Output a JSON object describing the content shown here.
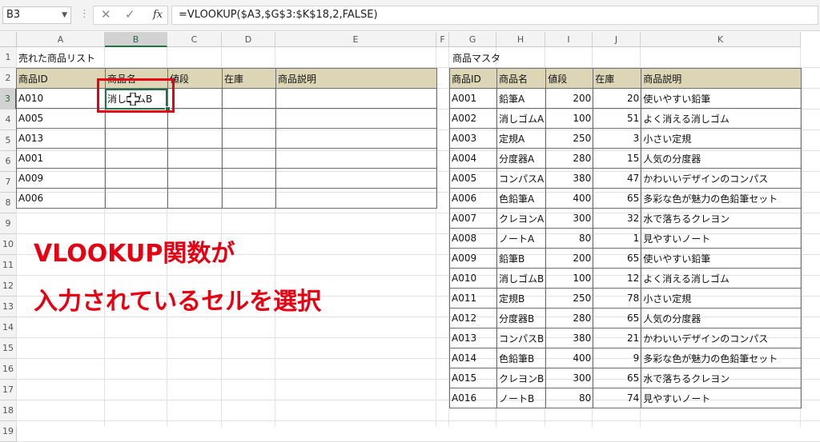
{
  "formula_bar": {
    "name_box": "B3",
    "more_icon": "more-vertical-icon",
    "cancel_icon": "cancel-icon",
    "enter_icon": "check-icon",
    "fx_label": "fx",
    "formula": "=VLOOKUP($A3,$G$3:$K$18,2,FALSE)"
  },
  "columns": [
    "A",
    "B",
    "C",
    "D",
    "E",
    "F",
    "G",
    "H",
    "I",
    "J",
    "K"
  ],
  "selected_column": "B",
  "rows": [
    "1",
    "2",
    "3",
    "4",
    "5",
    "6",
    "7",
    "8",
    "9",
    "10",
    "11",
    "12",
    "13",
    "14",
    "15",
    "16",
    "17",
    "18",
    "19"
  ],
  "selected_row": "3",
  "sold_list": {
    "title": "売れた商品リスト",
    "headers": [
      "商品ID",
      "商品名",
      "値段",
      "在庫",
      "商品説明"
    ],
    "rows": [
      [
        "A010",
        "消しゴムB",
        "",
        "",
        ""
      ],
      [
        "A005",
        "",
        "",
        "",
        ""
      ],
      [
        "A013",
        "",
        "",
        "",
        ""
      ],
      [
        "A001",
        "",
        "",
        "",
        ""
      ],
      [
        "A009",
        "",
        "",
        "",
        ""
      ],
      [
        "A006",
        "",
        "",
        "",
        ""
      ]
    ]
  },
  "master": {
    "title": "商品マスタ",
    "headers": [
      "商品ID",
      "商品名",
      "値段",
      "在庫",
      "商品説明"
    ],
    "rows": [
      [
        "A001",
        "鉛筆A",
        "200",
        "20",
        "使いやすい鉛筆"
      ],
      [
        "A002",
        "消しゴムA",
        "100",
        "51",
        "よく消える消しゴム"
      ],
      [
        "A003",
        "定規A",
        "250",
        "3",
        "小さい定規"
      ],
      [
        "A004",
        "分度器A",
        "280",
        "15",
        "人気の分度器"
      ],
      [
        "A005",
        "コンパスA",
        "380",
        "47",
        "かわいいデザインのコンパス"
      ],
      [
        "A006",
        "色鉛筆A",
        "400",
        "65",
        "多彩な色が魅力の色鉛筆セット"
      ],
      [
        "A007",
        "クレヨンA",
        "300",
        "32",
        "水で落ちるクレヨン"
      ],
      [
        "A008",
        "ノートA",
        "80",
        "1",
        "見やすいノート"
      ],
      [
        "A009",
        "鉛筆B",
        "200",
        "65",
        "使いやすい鉛筆"
      ],
      [
        "A010",
        "消しゴムB",
        "100",
        "12",
        "よく消える消しゴム"
      ],
      [
        "A011",
        "定規B",
        "250",
        "78",
        "小さい定規"
      ],
      [
        "A012",
        "分度器B",
        "280",
        "65",
        "人気の分度器"
      ],
      [
        "A013",
        "コンパスB",
        "380",
        "21",
        "かわいいデザインのコンパス"
      ],
      [
        "A014",
        "色鉛筆B",
        "400",
        "9",
        "多彩な色が魅力の色鉛筆セット"
      ],
      [
        "A015",
        "クレヨンB",
        "300",
        "65",
        "水で落ちるクレヨン"
      ],
      [
        "A016",
        "ノートB",
        "80",
        "74",
        "見やすいノート"
      ]
    ]
  },
  "annotation": {
    "line1": "VLOOKUP関数が",
    "line2": "入力されているセルを選択"
  },
  "colors": {
    "accent_red": "#e60012",
    "excel_green": "#217346",
    "header_fill": "#dcd6b6"
  }
}
